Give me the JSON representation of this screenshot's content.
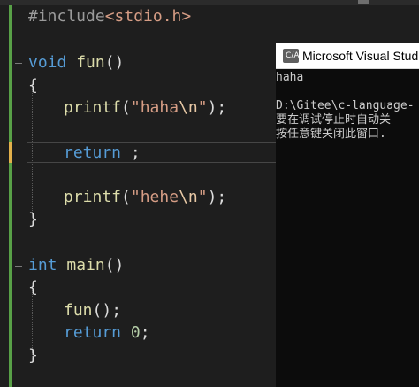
{
  "editor": {
    "lines": [
      {
        "pre": "#include",
        "header": "<stdio.h>"
      },
      {
        "kw": "void",
        "fn": "fun",
        "rest": "()"
      },
      {
        "brace": "{"
      },
      {
        "fn": "printf",
        "open": "(",
        "str": "\"haha",
        "esc": "\\n",
        "strEnd": "\"",
        "close": ");"
      },
      {
        "kw": "return",
        "rest": " ;"
      },
      {
        "fn": "printf",
        "open": "(",
        "str": "\"hehe",
        "esc": "\\n",
        "strEnd": "\"",
        "close": ");"
      },
      {
        "brace": "}"
      },
      {
        "kw": "int",
        "fn": "main",
        "rest": "()"
      },
      {
        "brace": "{"
      },
      {
        "fn": "fun",
        "rest": "();"
      },
      {
        "kw": "return",
        "num": "0",
        "rest": ";"
      },
      {
        "brace": "}"
      }
    ]
  },
  "console": {
    "icon": "C/A",
    "title": "Microsoft Visual Studio",
    "output": [
      "haha",
      "",
      "D:\\Gitee\\c-language-",
      "要在调试停止时自动关",
      "按任意键关闭此窗口."
    ]
  },
  "colors": {
    "background": "#1e1e1e",
    "keyword": "#569cd6",
    "function": "#dcdcaa",
    "string": "#d69d85",
    "gutter_saved": "#58a047",
    "gutter_changed": "#e3b14b",
    "console_bg": "#0c0c0c"
  }
}
